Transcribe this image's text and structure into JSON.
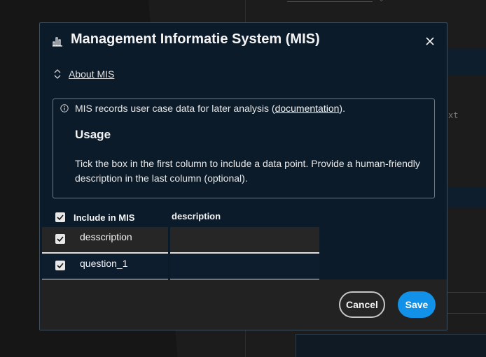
{
  "modal": {
    "title": "Management Informatie System (MIS)",
    "title_icon": "bar-chart-icon",
    "close_icon": "close-icon"
  },
  "about": {
    "label": "About MIS",
    "icon": "collapse-chevron-icon"
  },
  "info": {
    "icon": "info-icon",
    "text_before": "MIS records user case data for later analysis (",
    "link_text": "documentation",
    "text_after": ").",
    "usage_heading": "Usage",
    "usage_body": "Tick the box in the first column to include a data point. Provide a human-friendly description in the last column (optional)."
  },
  "table": {
    "headers": {
      "include": "Include in MIS",
      "description": "description"
    },
    "header_checked": true,
    "rows": [
      {
        "label": "desscription",
        "checked": true,
        "description": ""
      },
      {
        "label": "question_1",
        "checked": true,
        "description": ""
      }
    ]
  },
  "footer": {
    "cancel_label": "Cancel",
    "save_label": "Save"
  },
  "background": {
    "partial_text": "xt"
  },
  "colors": {
    "modal_bg": "#0c1b2a",
    "row_bg_1": "#262626",
    "row_bg_2": "#0e1d2e",
    "footer_bg": "#222222",
    "primary": "#1192e8"
  }
}
